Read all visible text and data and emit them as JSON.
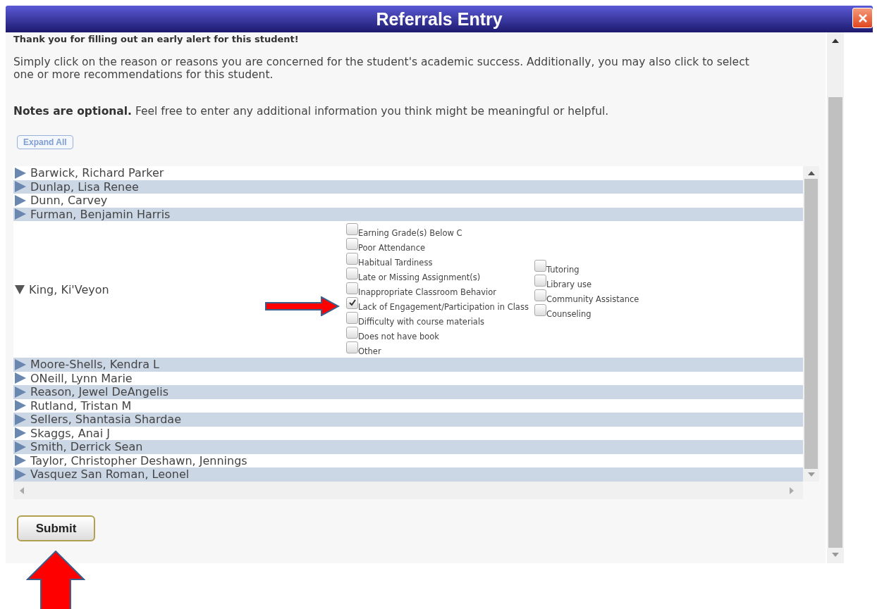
{
  "window": {
    "title": "Referrals Entry"
  },
  "intro": {
    "heading": "Thank you for filling out an early alert for this student!",
    "instructions": "Simply click on the reason or reasons you are concerned for the student's academic success. Additionally, you may also click to select one or more recommendations for this student.",
    "notes": "**Notes are optional.** Feel free to enter any additional information you think might be meaningful or helpful."
  },
  "expand_all_button": "Expand All",
  "students": [
    {
      "name": "Barwick, Richard Parker",
      "expanded": false
    },
    {
      "name": "Dunlap, Lisa Renee",
      "expanded": false
    },
    {
      "name": "Dunn, Carvey",
      "expanded": false
    },
    {
      "name": "Furman, Benjamin Harris",
      "expanded": false
    },
    {
      "name": "King, Ki'Veyon",
      "expanded": true,
      "reasons": [
        {
          "label": "Earning Grade(s) Below C",
          "checked": false
        },
        {
          "label": "Poor Attendance",
          "checked": false
        },
        {
          "label": "Habitual Tardiness",
          "checked": false
        },
        {
          "label": "Late or Missing Assignment(s)",
          "checked": false
        },
        {
          "label": "Inappropriate Classroom Behavior",
          "checked": false
        },
        {
          "label": "Lack of Engagement/Participation in Class",
          "checked": true
        },
        {
          "label": "Difficulty with course materials",
          "checked": false
        },
        {
          "label": "Does not have book",
          "checked": false
        },
        {
          "label": "Other",
          "checked": false
        }
      ],
      "recommendations": [
        {
          "label": "Tutoring",
          "checked": false
        },
        {
          "label": "Library use",
          "checked": false
        },
        {
          "label": "Community Assistance",
          "checked": false
        },
        {
          "label": "Counseling",
          "checked": false
        }
      ]
    },
    {
      "name": "Moore-Shells, Kendra L",
      "expanded": false
    },
    {
      "name": "ONeill, Lynn Marie",
      "expanded": false
    },
    {
      "name": "Reason, Jewel DeAngelis",
      "expanded": false
    },
    {
      "name": "Rutland, Tristan M",
      "expanded": false
    },
    {
      "name": "Sellers, Shantasia Shardae",
      "expanded": false
    },
    {
      "name": "Skaggs, Anai J",
      "expanded": false
    },
    {
      "name": "Smith, Derrick Sean",
      "expanded": false
    },
    {
      "name": "Taylor, Christopher Deshawn, Jennings",
      "expanded": false
    },
    {
      "name": "Vasquez San Roman, Leonel",
      "expanded": false
    }
  ],
  "submit_button": "Submit"
}
